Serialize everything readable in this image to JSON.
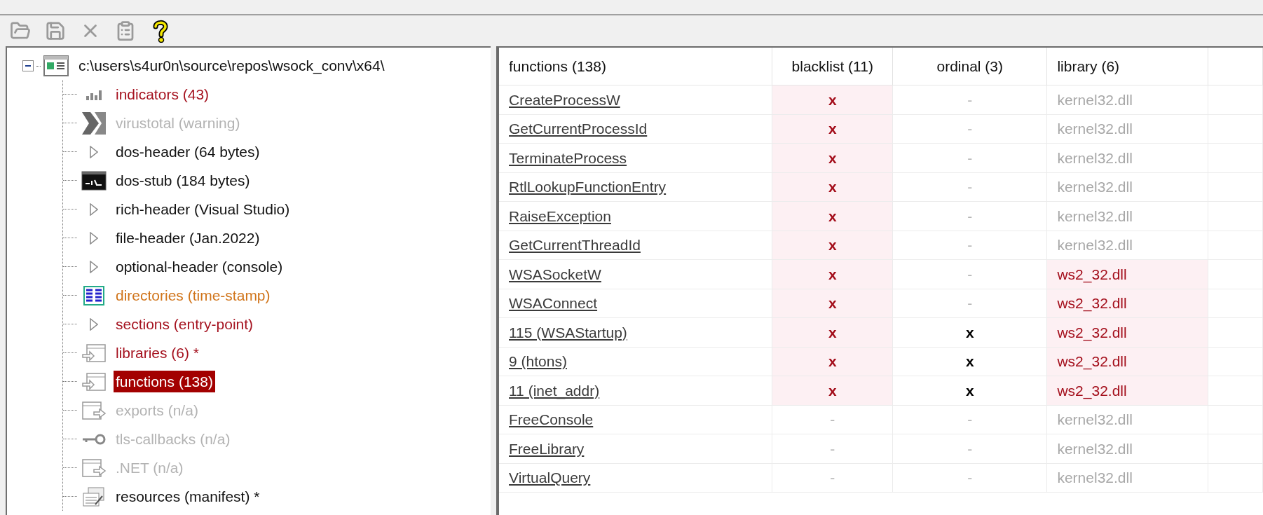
{
  "toolbar": [
    {
      "kind": "open",
      "disabled": true
    },
    {
      "kind": "save",
      "disabled": true
    },
    {
      "kind": "cut",
      "disabled": true
    },
    {
      "kind": "clipboard",
      "disabled": true
    },
    {
      "kind": "help",
      "disabled": false
    }
  ],
  "tree": {
    "root": {
      "label": "c:\\users\\s4ur0n\\source\\repos\\wsock_conv\\x64\\",
      "expanded": true
    },
    "children": [
      {
        "label": "indicators (43)",
        "kind": "bars",
        "color": "#a5121f",
        "selected": false
      },
      {
        "label": "virustotal (warning)",
        "kind": "chevron",
        "color": "#b3b3b3",
        "selected": false
      },
      {
        "label": "dos-header (64 bytes)",
        "kind": "arrow",
        "color": "#111111",
        "selected": false
      },
      {
        "label": "dos-stub (184 bytes)",
        "kind": "console",
        "color": "#111111",
        "selected": false
      },
      {
        "label": "rich-header (Visual Studio)",
        "kind": "arrow",
        "color": "#111111",
        "selected": false
      },
      {
        "label": "file-header (Jan.2022)",
        "kind": "arrow",
        "color": "#111111",
        "selected": false
      },
      {
        "label": "optional-header (console)",
        "kind": "arrow",
        "color": "#111111",
        "selected": false
      },
      {
        "label": "directories (time-stamp)",
        "kind": "grid",
        "color": "#d0741a",
        "selected": false
      },
      {
        "label": "sections (entry-point)",
        "kind": "arrow",
        "color": "#a5121f",
        "selected": false
      },
      {
        "label": "libraries (6) *",
        "kind": "import",
        "color": "#a5121f",
        "selected": false
      },
      {
        "label": "functions (138)",
        "kind": "import",
        "color": "#a30000",
        "selected": true
      },
      {
        "label": "exports (n/a)",
        "kind": "export",
        "color": "#b3b3b3",
        "selected": false
      },
      {
        "label": "tls-callbacks (n/a)",
        "kind": "key",
        "color": "#b3b3b3",
        "selected": false
      },
      {
        "label": ".NET (n/a)",
        "kind": "export",
        "color": "#b3b3b3",
        "selected": false
      },
      {
        "label": "resources (manifest) *",
        "kind": "resource",
        "color": "#111111",
        "selected": false
      }
    ]
  },
  "table": {
    "columns": [
      "functions (138)",
      "blacklist (11)",
      "ordinal (3)",
      "library (6)"
    ],
    "rows": [
      {
        "function": "CreateProcessW",
        "blacklist": "x",
        "blacklist_flagged": true,
        "ordinal": "-",
        "ordinal_flagged": false,
        "library": "kernel32.dll",
        "library_flagged": false
      },
      {
        "function": "GetCurrentProcessId",
        "blacklist": "x",
        "blacklist_flagged": true,
        "ordinal": "-",
        "ordinal_flagged": false,
        "library": "kernel32.dll",
        "library_flagged": false
      },
      {
        "function": "TerminateProcess",
        "blacklist": "x",
        "blacklist_flagged": true,
        "ordinal": "-",
        "ordinal_flagged": false,
        "library": "kernel32.dll",
        "library_flagged": false
      },
      {
        "function": "RtlLookupFunctionEntry",
        "blacklist": "x",
        "blacklist_flagged": true,
        "ordinal": "-",
        "ordinal_flagged": false,
        "library": "kernel32.dll",
        "library_flagged": false
      },
      {
        "function": "RaiseException",
        "blacklist": "x",
        "blacklist_flagged": true,
        "ordinal": "-",
        "ordinal_flagged": false,
        "library": "kernel32.dll",
        "library_flagged": false
      },
      {
        "function": "GetCurrentThreadId",
        "blacklist": "x",
        "blacklist_flagged": true,
        "ordinal": "-",
        "ordinal_flagged": false,
        "library": "kernel32.dll",
        "library_flagged": false
      },
      {
        "function": "WSASocketW",
        "blacklist": "x",
        "blacklist_flagged": true,
        "ordinal": "-",
        "ordinal_flagged": false,
        "library": "ws2_32.dll",
        "library_flagged": true
      },
      {
        "function": "WSAConnect",
        "blacklist": "x",
        "blacklist_flagged": true,
        "ordinal": "-",
        "ordinal_flagged": false,
        "library": "ws2_32.dll",
        "library_flagged": true
      },
      {
        "function": "115 (WSAStartup)",
        "blacklist": "x",
        "blacklist_flagged": true,
        "ordinal": "x",
        "ordinal_flagged": true,
        "library": "ws2_32.dll",
        "library_flagged": true
      },
      {
        "function": "9 (htons)",
        "blacklist": "x",
        "blacklist_flagged": true,
        "ordinal": "x",
        "ordinal_flagged": true,
        "library": "ws2_32.dll",
        "library_flagged": true
      },
      {
        "function": "11 (inet_addr)",
        "blacklist": "x",
        "blacklist_flagged": true,
        "ordinal": "x",
        "ordinal_flagged": true,
        "library": "ws2_32.dll",
        "library_flagged": true
      },
      {
        "function": "FreeConsole",
        "blacklist": "-",
        "blacklist_flagged": false,
        "ordinal": "-",
        "ordinal_flagged": false,
        "library": "kernel32.dll",
        "library_flagged": false
      },
      {
        "function": "FreeLibrary",
        "blacklist": "-",
        "blacklist_flagged": false,
        "ordinal": "-",
        "ordinal_flagged": false,
        "library": "kernel32.dll",
        "library_flagged": false
      },
      {
        "function": "VirtualQuery",
        "blacklist": "-",
        "blacklist_flagged": false,
        "ordinal": "-",
        "ordinal_flagged": false,
        "library": "kernel32.dll",
        "library_flagged": false
      }
    ]
  }
}
